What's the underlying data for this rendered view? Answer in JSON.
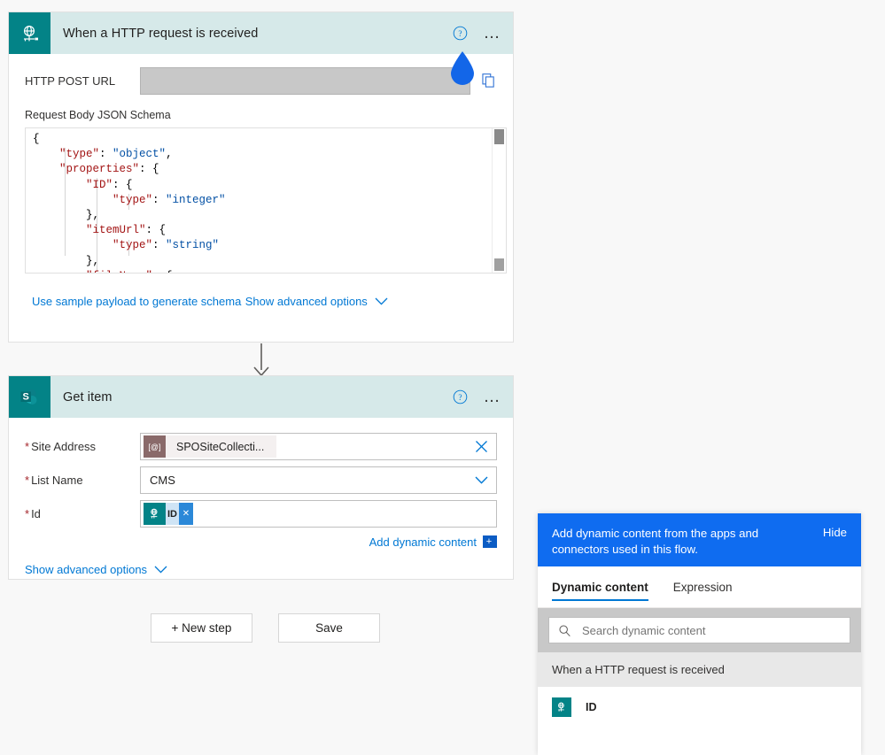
{
  "trigger_card": {
    "icon": "http-globe-icon",
    "title": "When a HTTP request is received",
    "help_icon": "help-circle-icon",
    "menu_icon": "ellipsis-icon",
    "post_url_label": "HTTP POST URL",
    "post_url_value": "",
    "copy_icon": "copy-icon",
    "schema_label": "Request Body JSON Schema",
    "schema_lines": [
      {
        "indent": 0,
        "parts": [
          {
            "t": "{",
            "c": "p"
          }
        ]
      },
      {
        "indent": 1,
        "parts": [
          {
            "t": "\"type\"",
            "c": "k"
          },
          {
            "t": ": ",
            "c": "p"
          },
          {
            "t": "\"object\"",
            "c": "v"
          },
          {
            "t": ",",
            "c": "p"
          }
        ]
      },
      {
        "indent": 1,
        "parts": [
          {
            "t": "\"properties\"",
            "c": "k"
          },
          {
            "t": ": {",
            "c": "p"
          }
        ]
      },
      {
        "indent": 2,
        "parts": [
          {
            "t": "\"ID\"",
            "c": "k"
          },
          {
            "t": ": {",
            "c": "p"
          }
        ]
      },
      {
        "indent": 3,
        "parts": [
          {
            "t": "\"type\"",
            "c": "k"
          },
          {
            "t": ": ",
            "c": "p"
          },
          {
            "t": "\"integer\"",
            "c": "v"
          }
        ]
      },
      {
        "indent": 2,
        "parts": [
          {
            "t": "},",
            "c": "p"
          }
        ]
      },
      {
        "indent": 2,
        "parts": [
          {
            "t": "\"itemUrl\"",
            "c": "k"
          },
          {
            "t": ": {",
            "c": "p"
          }
        ]
      },
      {
        "indent": 3,
        "parts": [
          {
            "t": "\"type\"",
            "c": "k"
          },
          {
            "t": ": ",
            "c": "p"
          },
          {
            "t": "\"string\"",
            "c": "v"
          }
        ]
      },
      {
        "indent": 2,
        "parts": [
          {
            "t": "},",
            "c": "p"
          }
        ]
      },
      {
        "indent": 2,
        "parts": [
          {
            "t": "\"fileName\"",
            "c": "k"
          },
          {
            "t": ": {",
            "c": "p"
          }
        ]
      }
    ],
    "sample_payload_link": "Use sample payload to generate schema",
    "advanced_link": "Show advanced options",
    "chevron_icon": "chevron-down-icon"
  },
  "connector_arrow": {
    "icon": "arrow-down-icon"
  },
  "action_card": {
    "icon": "sharepoint-icon",
    "title": "Get item",
    "help_icon": "help-circle-icon",
    "menu_icon": "ellipsis-icon",
    "fields": {
      "site_address": {
        "label": "Site Address",
        "required": true,
        "token_icon_text": "[@]",
        "token_label": "SPOSiteCollecti...",
        "clear_icon": "close-x-icon"
      },
      "list_name": {
        "label": "List Name",
        "required": true,
        "value": "CMS",
        "dropdown_icon": "chevron-down-icon"
      },
      "id": {
        "label": "Id",
        "required": true,
        "token_icon": "http-globe-icon",
        "token_label": "ID",
        "token_remove_icon": "close-x-icon"
      }
    },
    "add_dynamic_content_link": "Add dynamic content",
    "add_dynamic_content_badge": "+",
    "advanced_link": "Show advanced options",
    "chevron_icon": "chevron-down-icon"
  },
  "footer": {
    "new_step_label": "+ New step",
    "save_label": "Save"
  },
  "dynamic_content_panel": {
    "banner_text": "Add dynamic content from the apps and connectors used in this flow.",
    "hide_label": "Hide",
    "tabs": [
      {
        "label": "Dynamic content",
        "active": true
      },
      {
        "label": "Expression",
        "active": false
      }
    ],
    "search_icon": "search-icon",
    "search_placeholder": "Search dynamic content",
    "search_value": "",
    "group_label": "When a HTTP request is received",
    "items": [
      {
        "icon": "http-globe-icon",
        "label": "ID"
      }
    ]
  },
  "cursor": {
    "icon": "water-drop-cursor"
  },
  "colors": {
    "connector_teal": "#038387",
    "card_header_tint": "#d6e9e9",
    "link_blue": "#0078d4",
    "banner_blue": "#0f6cf0",
    "required_red": "#a4262c",
    "cursor_blue": "#1366e8",
    "page_bg": "#f8f8f8"
  }
}
